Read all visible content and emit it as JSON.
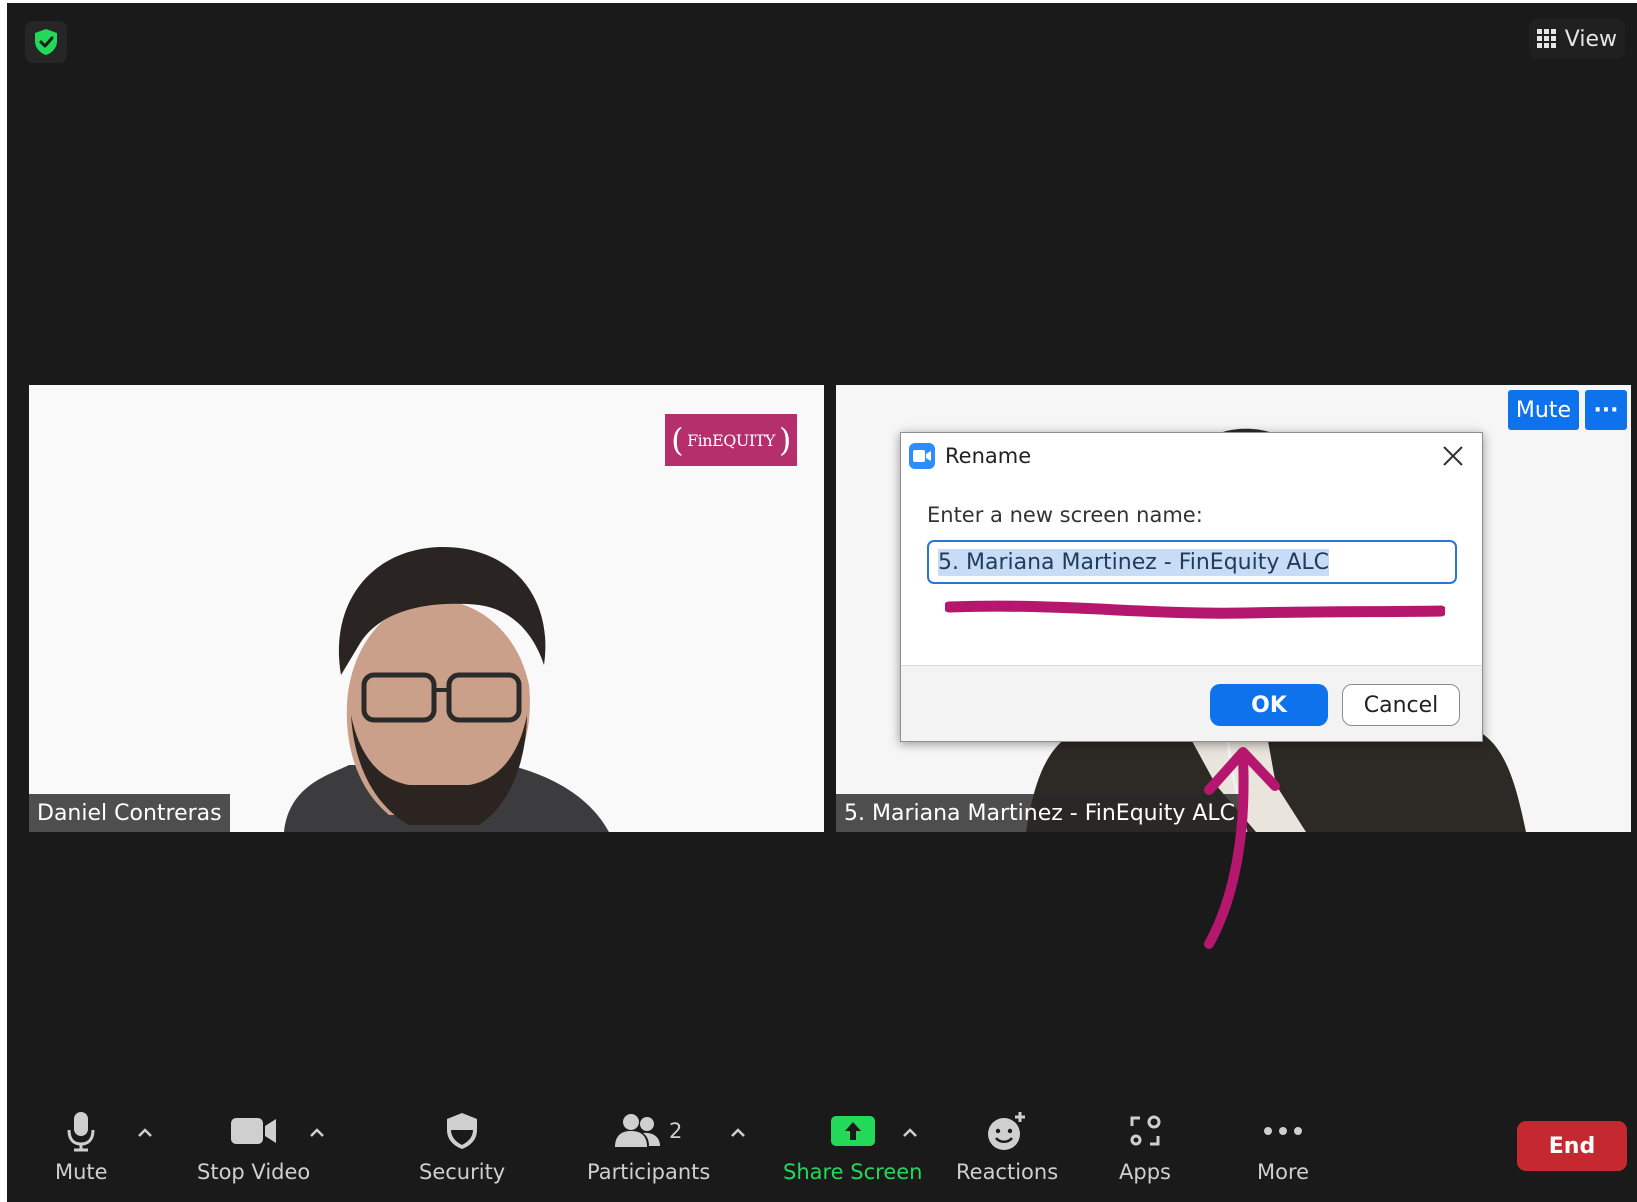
{
  "top": {
    "view_label": "View"
  },
  "tiles": {
    "left": {
      "name": "Daniel Contreras",
      "logo_text": "FinEQUITY"
    },
    "right": {
      "name": "5. Mariana Martinez - FinEquity ALC",
      "mute_label": "Mute",
      "more_label": "···"
    }
  },
  "dialog": {
    "title": "Rename",
    "prompt": "Enter a new screen name:",
    "input_value": "5. Mariana Martinez - FinEquity ALC",
    "ok_label": "OK",
    "cancel_label": "Cancel"
  },
  "toolbar": {
    "mute": "Mute",
    "stop_video": "Stop Video",
    "security": "Security",
    "participants": "Participants",
    "participant_count": "2",
    "share_screen": "Share Screen",
    "reactions": "Reactions",
    "apps": "Apps",
    "more": "More",
    "end": "End"
  },
  "colors": {
    "background": "#1a1a1a",
    "accent_blue": "#0e72ed",
    "share_green": "#23d959",
    "end_red": "#c5282f",
    "annotation_magenta": "#b5176f",
    "security_green": "#23d959"
  }
}
